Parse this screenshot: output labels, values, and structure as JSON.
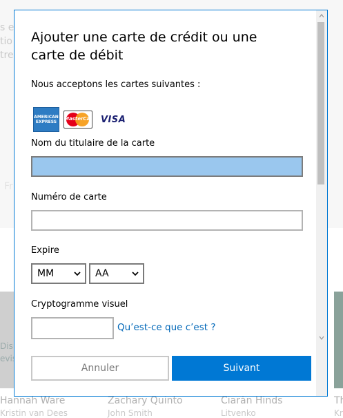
{
  "background": {
    "left_fragments": [
      "s e",
      "tio",
      "tre"
    ],
    "left_faint": "Fr",
    "tile_text_left": "Disn",
    "tile_text_left2": "evis",
    "cast": [
      {
        "name": "Hannah Ware",
        "sub": "Kristin van Dees"
      },
      {
        "name": "Zachary Quinto",
        "sub": "John Smith"
      },
      {
        "name": "Ciarán Hinds",
        "sub": "Litvenko"
      },
      {
        "name": "Th",
        "sub": "Kr"
      }
    ]
  },
  "dialog": {
    "title": "Ajouter une carte de crédit ou une carte de débit",
    "accepted_label": "Nous acceptons les cartes suivantes :",
    "cards": {
      "amex_line1": "AMERICAN",
      "amex_line2": "EXPRESS",
      "mastercard": "MasterCard",
      "visa": "VISA"
    },
    "holder_label": "Nom du titulaire de la carte",
    "holder_value": "",
    "number_label": "Numéro de carte",
    "number_value": "",
    "expire_label": "Expire",
    "month_value": "MM",
    "year_value": "AA",
    "cvv_label": "Cryptogramme visuel",
    "cvv_value": "",
    "cvv_help_link": "Qu’est-ce que c’est ?",
    "cancel_button": "Annuler",
    "next_button": "Suivant"
  },
  "colors": {
    "accent": "#0078d4",
    "link": "#0067b8",
    "focused_field": "#9ac7ee"
  }
}
